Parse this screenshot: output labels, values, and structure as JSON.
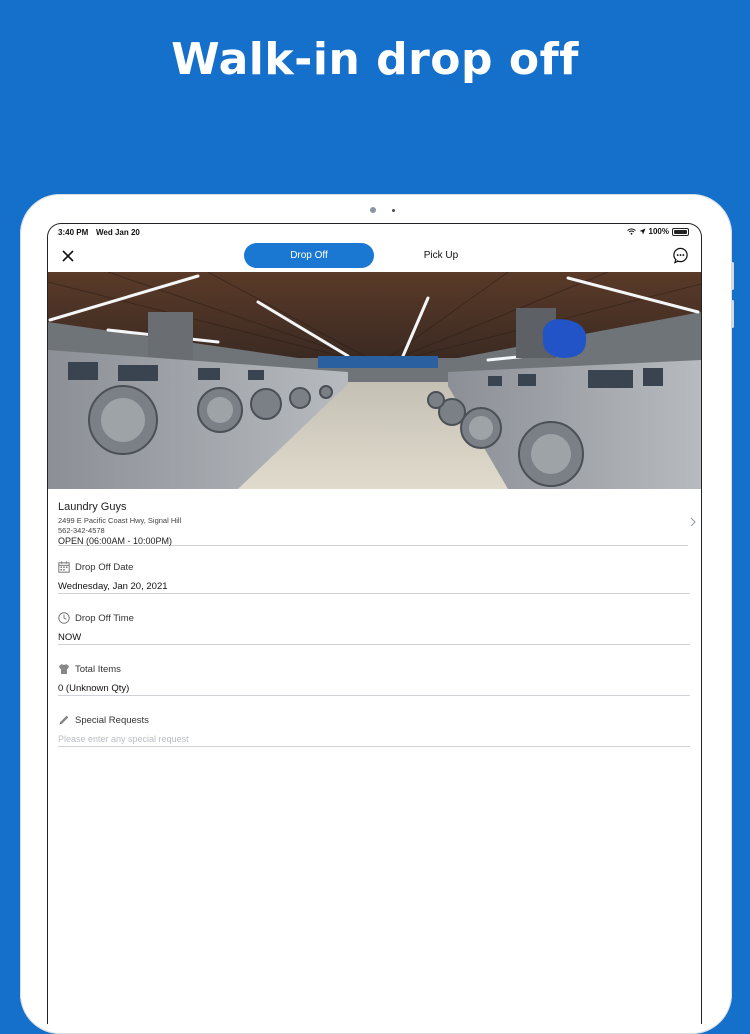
{
  "headline": "Walk-in drop off",
  "status_bar": {
    "time": "3:40 PM",
    "date": "Wed Jan 20",
    "battery": "100%"
  },
  "nav": {
    "tabs": [
      {
        "label": "Drop Off",
        "active": true
      },
      {
        "label": "Pick Up",
        "active": false
      }
    ]
  },
  "store": {
    "name": "Laundry Guys",
    "address": "2499 E Pacific Coast Hwy, Signal Hill",
    "phone": "562-342-4578",
    "hours": "OPEN (06:00AM - 10:00PM)"
  },
  "fields": {
    "drop_off_date": {
      "label": "Drop Off Date",
      "value": "Wednesday, Jan 20, 2021",
      "icon": "calendar-icon"
    },
    "drop_off_time": {
      "label": "Drop Off Time",
      "value": "NOW",
      "icon": "clock-icon"
    },
    "total_items": {
      "label": "Total Items",
      "value": "0 (Unknown Qty)",
      "icon": "shirt-icon"
    },
    "special_requests": {
      "label": "Special Requests",
      "placeholder": "Please enter any special request",
      "icon": "pencil-icon"
    }
  },
  "carousel": {
    "pages": 4,
    "current": 1
  },
  "colors": {
    "background": "#1570cc",
    "accent": "#1a78d2"
  }
}
